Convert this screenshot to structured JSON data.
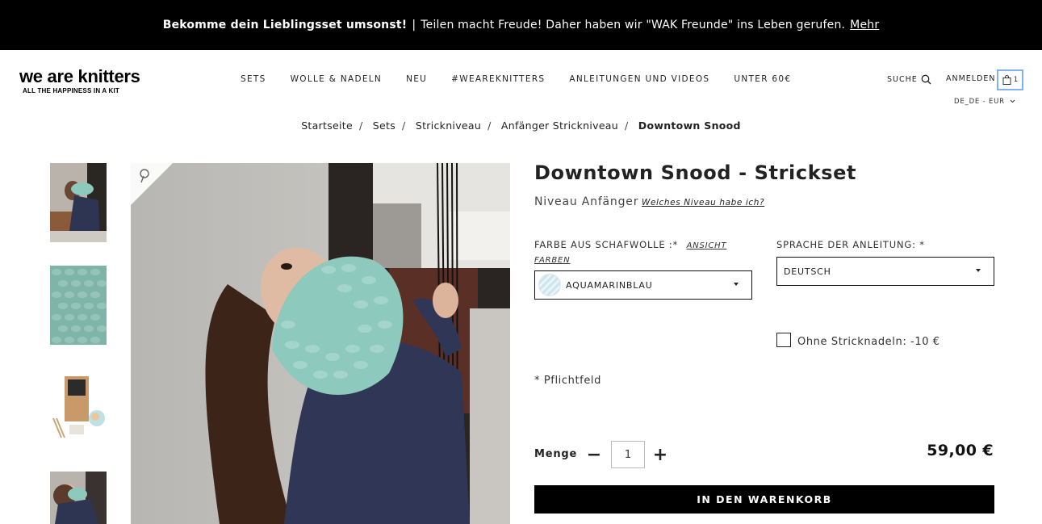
{
  "promo": {
    "bold_text": "Bekomme dein Lieblingsset umsonst!",
    "separator": "|",
    "text": "Teilen macht Freude! Daher haben wir \"WAK Freunde\" ins Leben gerufen.",
    "link": "Mehr"
  },
  "logo": {
    "brand": "we are knitters",
    "tagline": "ALL THE HAPPINESS IN A KIT"
  },
  "nav": [
    "SETS",
    "WOLLE & NADELN",
    "NEU",
    "#WEAREKNITTERS",
    "ANLEITUNGEN UND VIDEOS",
    "UNTER 60€"
  ],
  "utility": {
    "search": "SUCHE",
    "login": "ANMELDEN",
    "cart_count": "1",
    "locale": "DE_DE - EUR"
  },
  "breadcrumb": [
    "Startseite",
    "Sets",
    "Strickniveau",
    "Anfänger Strickniveau"
  ],
  "breadcrumb_current": "Downtown Snood",
  "product": {
    "title": "Downtown Snood - Strickset",
    "level": "Niveau Anfänger",
    "level_link": "Welches Niveau habe ich?",
    "color_label": "FARBE AUS SCHAFWOLLE :*",
    "color_link_1": "ANSICHT",
    "color_link_2": "FARBEN",
    "color_value": "AQUAMARINBLAU",
    "lang_label": "SPRACHE DER ANLEITUNG: *",
    "lang_value": "DEUTSCH",
    "no_needles": "Ohne Stricknadeln: -10 €",
    "required": "* Pflichtfeld",
    "qty_label": "Menge",
    "qty_minus": "−",
    "qty_plus": "+",
    "qty_value": "1",
    "price": "59,00 €",
    "add_to_cart": "IN DEN WARENKORB"
  },
  "colors": {
    "promo_bg": "#000000",
    "cart_outline": "#7fb3f0",
    "yarn": "#8ec9bd",
    "button_bg": "#000000"
  }
}
